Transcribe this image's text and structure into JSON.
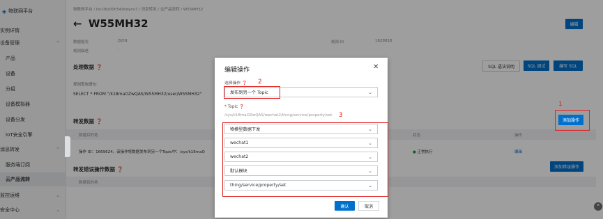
{
  "sidebar": {
    "brand": "物联网平台",
    "items": [
      "实例详情",
      "设备管理",
      "产品",
      "设备",
      "分组",
      "设备模拟器",
      "设备分发",
      "IoT安全引擎",
      "消息转发",
      "服务端订阅",
      "云产品流转",
      "监控运维",
      "安全中心"
    ]
  },
  "header": {
    "breadcrumb": [
      "物联网平台",
      "iot-06z00h54zbdyns7",
      "消息转发",
      "云产品流转",
      "W55MH32"
    ],
    "title": "W55MH32",
    "edit_label": "编辑"
  },
  "info": {
    "format_label": "数据格式",
    "format_value": "JSON",
    "rule_id_label": "规则 ID",
    "rule_id_value": "1828818",
    "desc_label": "规则描述",
    "desc_value": "-"
  },
  "process": {
    "section_title": "处理数据",
    "sql_help": "SQL 语法说明",
    "sql_debug": "SQL 调试",
    "sql_edit": "编写 SQL",
    "query_label": "规则查询语句:",
    "query_value": "SELECT * FROM \"/k18maOZwQAS/W55MH32/user/W55MH32\""
  },
  "forward": {
    "section_title": "转发数据",
    "add_label": "添加操作",
    "col_action": "数据目的地",
    "col_status": "状态",
    "col_op": "操作",
    "row_text": "操作 ID：1669624。该操作将数据发布到另一个Topic中：/sys/k18maO",
    "row_status": "正常执行",
    "row_op": "编辑"
  },
  "error": {
    "section_title": "转发错误操作数据",
    "add_label": "添加错误操作",
    "col_action": "数据目的地"
  },
  "modal": {
    "title": "编辑操作",
    "close": "✕",
    "select_label": "选择操作",
    "select_value": "发布到另一个 Topic",
    "topic_label": "Topic",
    "topic_placeholder": "/sys/k18maOZwQAS/wechat2/thing/service/property/set",
    "options": [
      "物模型数据下发",
      "wechat1",
      "wechat2",
      "默认模块",
      "thing/service/property/set"
    ],
    "confirm": "确认",
    "cancel": "取消"
  },
  "annotations": {
    "n1": "1",
    "n2": "2",
    "n3": "3"
  },
  "colors": {
    "accent": "#0070cc",
    "annotation": "#e02020",
    "status_ok": "#1e8e3e"
  }
}
